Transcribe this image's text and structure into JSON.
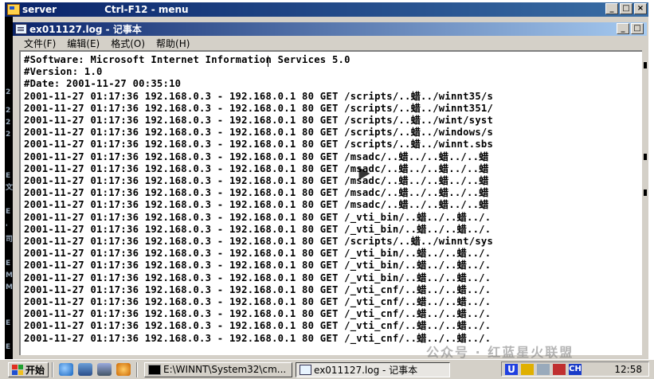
{
  "outer_window": {
    "title": "server",
    "title_hint": "Ctrl-F12 - menu",
    "buttons": {
      "minimize": "_",
      "maximize": "□",
      "close": "×"
    }
  },
  "left_strip_chars": [
    "2",
    "2",
    "2",
    "2",
    "E",
    "文",
    "E",
    "'",
    "司",
    "E",
    "M",
    "M",
    "E",
    "E"
  ],
  "notepad": {
    "title": "ex011127.log - 记事本",
    "buttons": {
      "minimize": "_",
      "maximize": "□"
    },
    "menu": [
      "文件(F)",
      "编辑(E)",
      "格式(O)",
      "帮助(H)"
    ],
    "lines": [
      "#Software: Microsoft Internet Information Services 5.0",
      "#Version: 1.0",
      "#Date: 2001-11-27 00:35:10",
      "2001-11-27 01:17:36 192.168.0.3 - 192.168.0.1 80 GET /scripts/..蜡../winnt35/s",
      "2001-11-27 01:17:36 192.168.0.3 - 192.168.0.1 80 GET /scripts/..蜡../winnt351/",
      "2001-11-27 01:17:36 192.168.0.3 - 192.168.0.1 80 GET /scripts/..蜡../wint/syst",
      "2001-11-27 01:17:36 192.168.0.3 - 192.168.0.1 80 GET /scripts/..蜡../windows/s",
      "2001-11-27 01:17:36 192.168.0.3 - 192.168.0.1 80 GET /scripts/..蜡../winnt.sbs",
      "2001-11-27 01:17:36 192.168.0.3 - 192.168.0.1 80 GET /msadc/..蜡../..蜡../..蜡",
      "2001-11-27 01:17:36 192.168.0.3 - 192.168.0.1 80 GET /msadc/..蜡../..蜡../..蜡",
      "2001-11-27 01:17:36 192.168.0.3 - 192.168.0.1 80 GET /msadc/..蜡../..蜡../..蜡",
      "2001-11-27 01:17:36 192.168.0.3 - 192.168.0.1 80 GET /msadc/..蜡../..蜡../..蜡",
      "2001-11-27 01:17:36 192.168.0.3 - 192.168.0.1 80 GET /msadc/..蜡../..蜡../..蜡",
      "2001-11-27 01:17:36 192.168.0.3 - 192.168.0.1 80 GET /_vti_bin/..蜡../..蜡../.",
      "2001-11-27 01:17:36 192.168.0.3 - 192.168.0.1 80 GET /_vti_bin/..蜡../..蜡../.",
      "2001-11-27 01:17:36 192.168.0.3 - 192.168.0.1 80 GET /scripts/..蜡../winnt/sys",
      "2001-11-27 01:17:36 192.168.0.3 - 192.168.0.1 80 GET /_vti_bin/..蜡../..蜡../.",
      "2001-11-27 01:17:36 192.168.0.3 - 192.168.0.1 80 GET /_vti_bin/..蜡../..蜡../.",
      "2001-11-27 01:17:36 192.168.0.3 - 192.168.0.1 80 GET /_vti_bin/..蜡../..蜡../.",
      "2001-11-27 01:17:36 192.168.0.3 - 192.168.0.1 80 GET /_vti_cnf/..蜡../..蜡../.",
      "2001-11-27 01:17:36 192.168.0.3 - 192.168.0.1 80 GET /_vti_cnf/..蜡../..蜡../.",
      "2001-11-27 01:17:36 192.168.0.3 - 192.168.0.1 80 GET /_vti_cnf/..蜡../..蜡../.",
      "2001-11-27 01:17:36 192.168.0.3 - 192.168.0.1 80 GET /_vti_cnf/..蜡../..蜡../.",
      "2001-11-27 01:17:36 192.168.0.3 - 192.168.0.1 80 GET /_vti_cnf/..蜡../..蜡../."
    ]
  },
  "taskbar": {
    "start_label": "开始",
    "tasks": [
      {
        "label": "E:\\WINNT\\System32\\cm...",
        "active": false
      },
      {
        "label": "ex011127.log - 记事本",
        "active": true
      }
    ],
    "clock": "12:58",
    "tray_ime": "CH"
  },
  "watermark": "公众号 · 红蓝星火联盟",
  "colors": {
    "title_bar_start": "#0a246a",
    "title_bar_end": "#a6caf0",
    "chrome": "#d4d0c8",
    "tray_ime_bg": "#1a3cc8"
  }
}
